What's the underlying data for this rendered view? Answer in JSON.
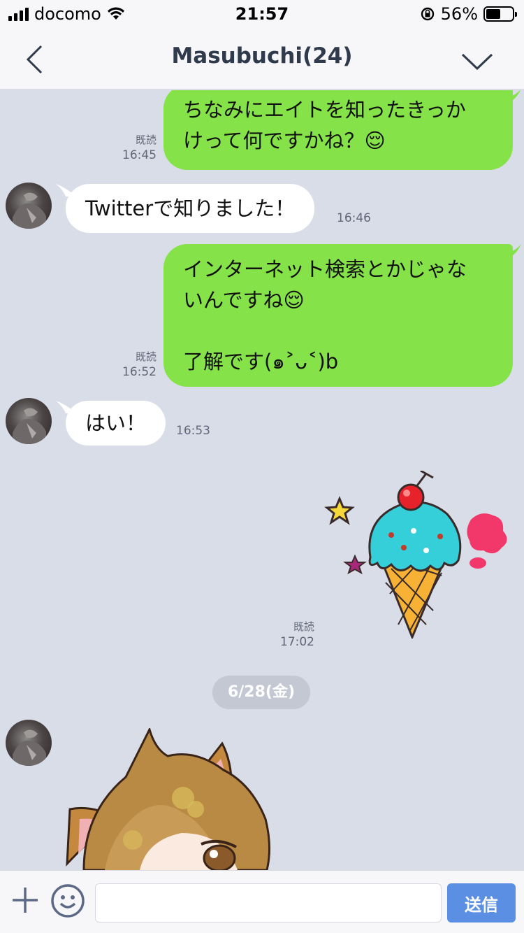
{
  "status_bar": {
    "carrier": "docomo",
    "time": "21:57",
    "battery": "56%"
  },
  "header": {
    "title": "Masubuchi(24)"
  },
  "messages": [
    {
      "side": "me",
      "lines": [
        "ちなみにエイトを知ったきっか",
        "けって何ですかね？😌"
      ],
      "read": "既読",
      "time": "16:45"
    },
    {
      "side": "them",
      "lines": [
        "Twitterで知りました！"
      ],
      "time": "16:46"
    },
    {
      "side": "me",
      "lines": [
        "インターネット検索とかじゃな",
        "いんですね😌",
        "",
        "了解です(๑˃ᴗ˂)b"
      ],
      "read": "既読",
      "time": "16:52"
    },
    {
      "side": "them",
      "lines": [
        "はい！"
      ],
      "time": "16:53"
    },
    {
      "side": "me",
      "type": "sticker",
      "sticker": "ice-cream",
      "read": "既読",
      "time": "17:02"
    }
  ],
  "date_separator": "6/28(金)",
  "input": {
    "placeholder": "",
    "send_label": "送信"
  }
}
